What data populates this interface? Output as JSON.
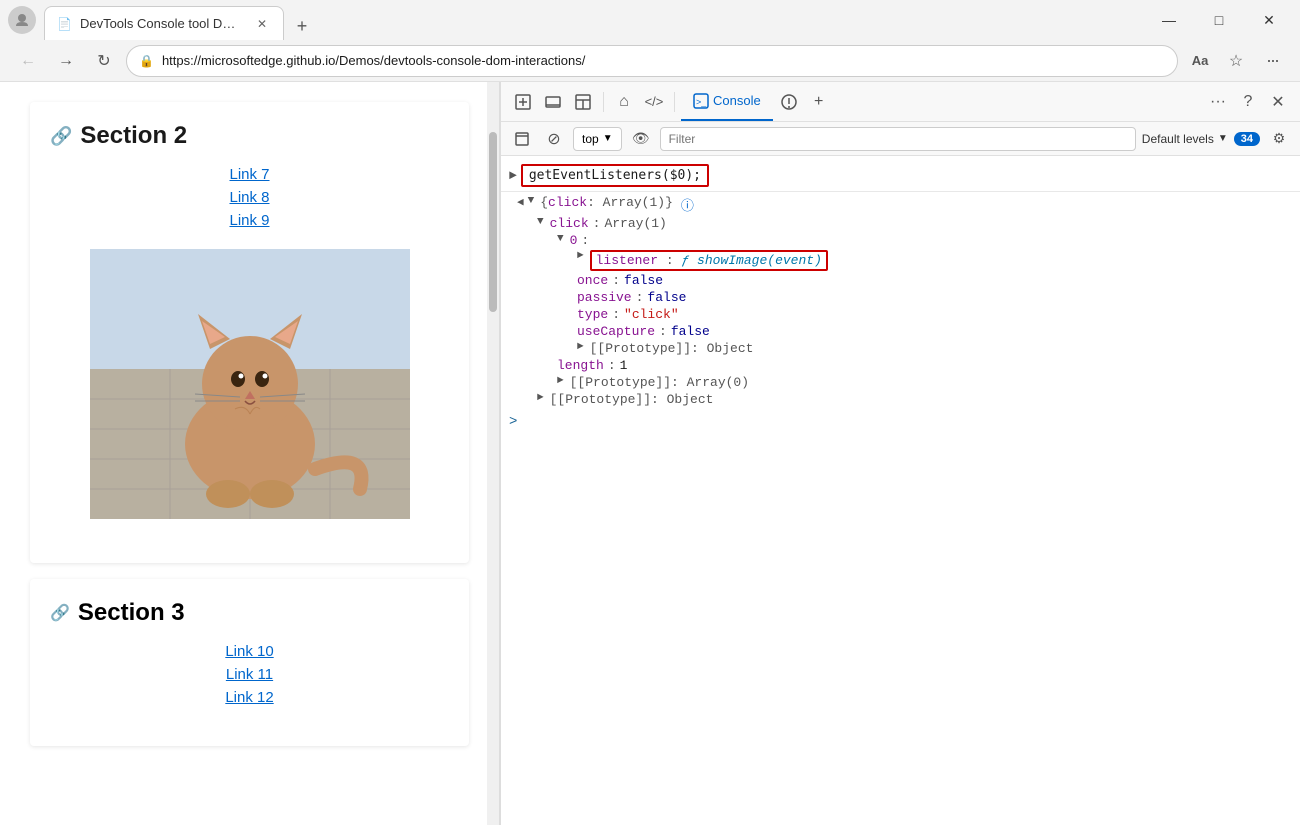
{
  "browser": {
    "title_bar": {
      "tab_title": "DevTools Console tool DOM inte",
      "new_tab_icon": "+",
      "minimize": "—",
      "maximize": "□",
      "close": "✕"
    },
    "nav_bar": {
      "back_title": "Back",
      "forward_title": "Forward",
      "refresh_title": "Refresh",
      "url": "https://microsoftedge.github.io/Demos/devtools-console-dom-interactions/",
      "lock_icon": "🔒",
      "reader_icon": "Aa",
      "favorites_icon": "☆",
      "more_icon": "..."
    }
  },
  "webpage": {
    "section2": {
      "heading": "Section 2",
      "anchor": "🔗",
      "links": [
        "Link 7",
        "Link 8",
        "Link 9"
      ]
    },
    "section3": {
      "heading": "Section 3",
      "anchor": "🔗",
      "links": [
        "Link 10",
        "Link 11",
        "Link 12"
      ]
    }
  },
  "devtools": {
    "toolbar": {
      "tabs": [
        "Console"
      ],
      "active_tab": "Console",
      "icons": {
        "inspect": "⬚",
        "device": "⬛",
        "layout": "▣",
        "home": "⌂",
        "source": "</>",
        "console": "Console",
        "issues": "🐛",
        "add": "+",
        "more": "...",
        "help": "?",
        "close": "✕"
      }
    },
    "console_bar": {
      "clear_icon": "⊘",
      "context": "top",
      "eye_icon": "👁",
      "filter_placeholder": "Filter",
      "levels_label": "Default levels",
      "message_count": "34",
      "settings_icon": "⚙"
    },
    "console_content": {
      "input_command": "getEventListeners($0);",
      "output": {
        "root": "{click: Array(1)}",
        "click_array": "click: Array(1)",
        "index_0": "0:",
        "listener_label": "listener:",
        "listener_value": "ƒ showImage(event)",
        "once_label": "once:",
        "once_value": "false",
        "passive_label": "passive:",
        "passive_value": "false",
        "type_label": "type:",
        "type_value": "\"click\"",
        "useCapture_label": "useCapture:",
        "useCapture_value": "false",
        "prototype1": "[[Prototype]]: Object",
        "length_label": "length:",
        "length_value": "1",
        "prototype2": "[[Prototype]]: Array(0)",
        "prototype3": "[[Prototype]]: Object"
      },
      "prompt_symbol": ">"
    }
  }
}
